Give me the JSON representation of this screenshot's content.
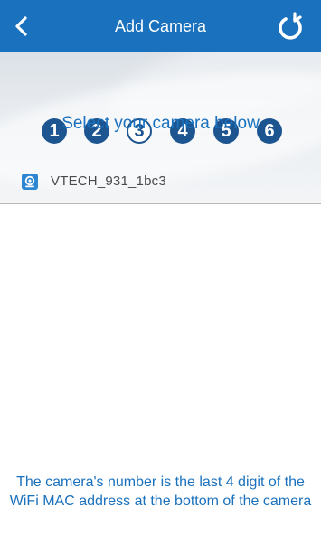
{
  "header": {
    "title": "Add Camera",
    "back_icon": "chevron-left-icon",
    "refresh_icon": "refresh-icon"
  },
  "steps": {
    "items": [
      "1",
      "2",
      "3",
      "4",
      "5",
      "6"
    ],
    "current": 3
  },
  "instruction": "Select your camera below",
  "camera_list": [
    {
      "name": "VTECH_931_1bc3",
      "icon": "camera-icon"
    }
  ],
  "footer_note": "The camera's number is the last 4 digit of the WiFi MAC address at the bottom of the camera",
  "colors": {
    "header_bg": "#1a71bd",
    "accent": "#1a71bd",
    "step_bg": "#1d5590"
  }
}
